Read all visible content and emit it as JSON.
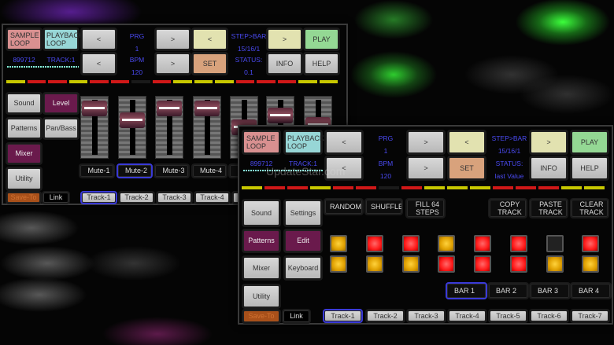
{
  "back_panel": {
    "top_buttons": [
      {
        "label": "SAMPLE LOOP",
        "style": "pink"
      },
      {
        "label": "PLAYBACK LOOP",
        "style": "cyan"
      },
      {
        "label": "<",
        "style": "gray"
      },
      {
        "label": ">",
        "style": "gray"
      },
      {
        "label": "<",
        "style": "yel"
      },
      {
        "label": ">",
        "style": "yel"
      },
      {
        "label": "PLAY",
        "style": "grn"
      },
      {
        "label": "<",
        "style": "gray"
      },
      {
        "label": ">",
        "style": "gray"
      },
      {
        "label": "SET",
        "style": "org"
      },
      {
        "label": "INFO",
        "style": "gray"
      },
      {
        "label": "HELP",
        "style": "gray"
      }
    ],
    "info": {
      "prg_label": "PRG",
      "prg": "1",
      "bpm_label": "BPM",
      "bpm": "120",
      "step_label": "STEP>BAR",
      "step": "15/16/1",
      "status_label": "STATUS:",
      "status": "0.1",
      "counter": "899712",
      "track": "TRACK:1"
    },
    "leds": [
      "Y",
      "R",
      "R",
      "Y",
      "R",
      "R",
      "K",
      "R",
      "Y",
      "Y",
      "Y",
      "R",
      "R",
      "R",
      "Y",
      "Y"
    ],
    "menu": [
      {
        "label": "Sound",
        "style": "gray"
      },
      {
        "label": "Level",
        "style": "pur"
      },
      {
        "label": "Patterns",
        "style": "gray"
      },
      {
        "label": "Pan/Bass",
        "style": "gray"
      },
      {
        "label": "Mixer",
        "style": "pur"
      },
      {
        "label": "Utility",
        "style": "gray"
      }
    ],
    "save_to": "Save-To",
    "link": "Link",
    "fader_levels": [
      0.95,
      0.7,
      0.95,
      0.95,
      0.55,
      0.8,
      0.6
    ],
    "mutes": [
      "Mute-1",
      "Mute-2",
      "Mute-3",
      "Mute-4",
      "M"
    ],
    "selected_mute": 1,
    "tracks": [
      "Track-1",
      "Track-2",
      "Track-3",
      "Track-4",
      "T"
    ],
    "selected_track": 0
  },
  "front_panel": {
    "top_buttons": [
      {
        "label": "SAMPLE LOOP",
        "style": "pink"
      },
      {
        "label": "PLAYBACK LOOP",
        "style": "cyan"
      },
      {
        "label": "<",
        "style": "gray"
      },
      {
        "label": ">",
        "style": "gray"
      },
      {
        "label": "<",
        "style": "yel"
      },
      {
        "label": ">",
        "style": "yel"
      },
      {
        "label": "PLAY",
        "style": "grn"
      },
      {
        "label": "<",
        "style": "gray"
      },
      {
        "label": ">",
        "style": "gray"
      },
      {
        "label": "SET",
        "style": "org"
      },
      {
        "label": "INFO",
        "style": "gray"
      },
      {
        "label": "HELP",
        "style": "gray"
      }
    ],
    "info": {
      "prg_label": "PRG",
      "prg": "1",
      "bpm_label": "BPM",
      "bpm": "120",
      "step_label": "STEP>BAR",
      "step": "15/16/1",
      "status_label": "STATUS:",
      "status": "last Value",
      "counter": "899712",
      "track": "TRACK:1"
    },
    "leds": [
      "Y",
      "R",
      "R",
      "Y",
      "R",
      "R",
      "K",
      "R",
      "Y",
      "Y",
      "Y",
      "R",
      "R",
      "R",
      "Y",
      "Y"
    ],
    "menu": [
      {
        "label": "Sound",
        "style": "gray"
      },
      {
        "label": "Settings",
        "style": "gray"
      },
      {
        "label": "Patterns",
        "style": "pur"
      },
      {
        "label": "Edit",
        "style": "pur"
      },
      {
        "label": "Mixer",
        "style": "gray"
      },
      {
        "label": "Keyboard",
        "style": "gray"
      },
      {
        "label": "Utility",
        "style": "gray"
      }
    ],
    "actions": [
      "RANDOM",
      "SHUFFLE",
      "FILL 64 STEPS",
      "COPY TRACK",
      "PASTE TRACK",
      "CLEAR TRACK"
    ],
    "pads": [
      [
        "O",
        "R",
        "R",
        "O",
        "R",
        "R",
        "K",
        "R"
      ],
      [
        "O",
        "O",
        "O",
        "R",
        "R",
        "R",
        "O",
        "O"
      ]
    ],
    "bars": [
      "BAR 1",
      "BAR 2",
      "BAR 3",
      "BAR 4"
    ],
    "selected_bar": 0,
    "save_to": "Save-To",
    "link": "Link",
    "tracks": [
      "Track-1",
      "Track-2",
      "Track-3",
      "Track-4",
      "Track-5",
      "Track-6",
      "Track-7"
    ],
    "selected_track": 0
  },
  "watermark": "UpdateStar.com",
  "colors": {
    "Y": "#c8c800",
    "R": "#d01818",
    "K": "#1a1a1a"
  }
}
